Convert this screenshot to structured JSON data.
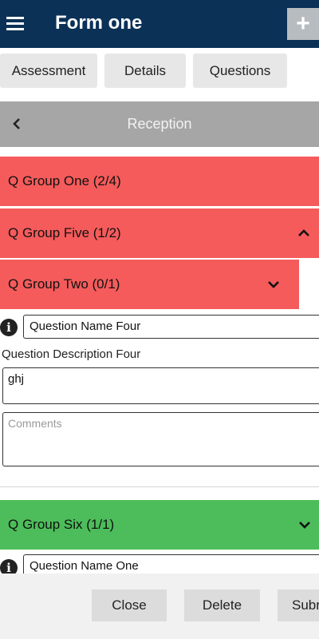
{
  "appbar": {
    "title": "Form one",
    "menu_icon": "hamburger-menu-icon",
    "add_icon": "plus-icon",
    "add_label": "+"
  },
  "tabs": [
    {
      "label": "Assessment"
    },
    {
      "label": "Details"
    },
    {
      "label": "Questions"
    }
  ],
  "section": {
    "title": "Reception",
    "back_icon": "chevron-left-icon"
  },
  "groups": [
    {
      "label": "Q Group One (2/4)",
      "status_color": "#f55b5b",
      "state": "none"
    },
    {
      "label": "Q Group Five (1/2)",
      "status_color": "#f55b5b",
      "state": "expanded"
    },
    {
      "label": "Q Group Two (0/1)",
      "status_color": "#f55b5b",
      "state": "collapsed"
    },
    {
      "label": "Q Group Six (1/1)",
      "status_color": "#4cbd5a",
      "state": "collapsed"
    }
  ],
  "question_four": {
    "info_icon": "info-icon",
    "info_glyph": "i",
    "name": "Question Name Four",
    "description": "Question Description Four",
    "answer": "ghj",
    "comments_placeholder": "Comments"
  },
  "question_one": {
    "info_icon": "info-icon",
    "info_glyph": "i",
    "name": "Question Name One"
  },
  "actions": {
    "close": "Close",
    "delete": "Delete",
    "submit": "Subr"
  },
  "colors": {
    "appbar": "#0b3157",
    "section_header": "#a6a6a6",
    "incomplete": "#f55b5b",
    "complete": "#4cbd5a"
  }
}
